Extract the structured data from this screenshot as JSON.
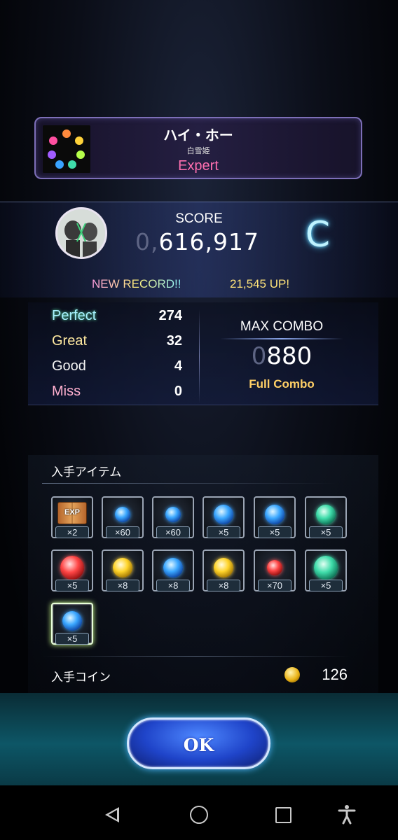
{
  "song": {
    "title": "ハイ・ホー",
    "subtitle": "白雪姫",
    "difficulty": "Expert"
  },
  "result": {
    "score_label": "SCORE",
    "score_prefix": "0,",
    "score_value": "616,917",
    "rank": "C",
    "new_record_label": "NEW RECORD!!",
    "record_up_label": "21,545 UP!"
  },
  "judgements": [
    {
      "name": "Perfect",
      "count": "274"
    },
    {
      "name": "Great",
      "count": "32"
    },
    {
      "name": "Good",
      "count": "4"
    },
    {
      "name": "Miss",
      "count": "0"
    }
  ],
  "combo": {
    "label": "MAX COMBO",
    "prefix": "0",
    "value": "880",
    "status": "Full Combo"
  },
  "items": {
    "heading": "入手アイテム",
    "list": [
      {
        "icon": "exp-book",
        "count": "×2"
      },
      {
        "icon": "blue-orb",
        "count": "×60"
      },
      {
        "icon": "blue-orb",
        "count": "×60"
      },
      {
        "icon": "blue-orb",
        "count": "×5"
      },
      {
        "icon": "blue-orb",
        "count": "×5"
      },
      {
        "icon": "green-orb",
        "count": "×5"
      },
      {
        "icon": "red-orb",
        "count": "×5"
      },
      {
        "icon": "yellow-orb",
        "count": "×8"
      },
      {
        "icon": "blue-orb",
        "count": "×8"
      },
      {
        "icon": "yellow-orb",
        "count": "×8"
      },
      {
        "icon": "red-orb",
        "count": "×70"
      },
      {
        "icon": "green-orb",
        "count": "×5"
      },
      {
        "icon": "blue-orb",
        "count": "×5"
      }
    ],
    "exp_label": "EXP"
  },
  "coins": {
    "label": "入手コイン",
    "value": "126"
  },
  "ok_button": "OK",
  "colors": {
    "difficulty": "#ff6fb0",
    "rank": "#bff3ff",
    "full_combo": "#ffcf66",
    "ok_button": "#1f44c9"
  }
}
